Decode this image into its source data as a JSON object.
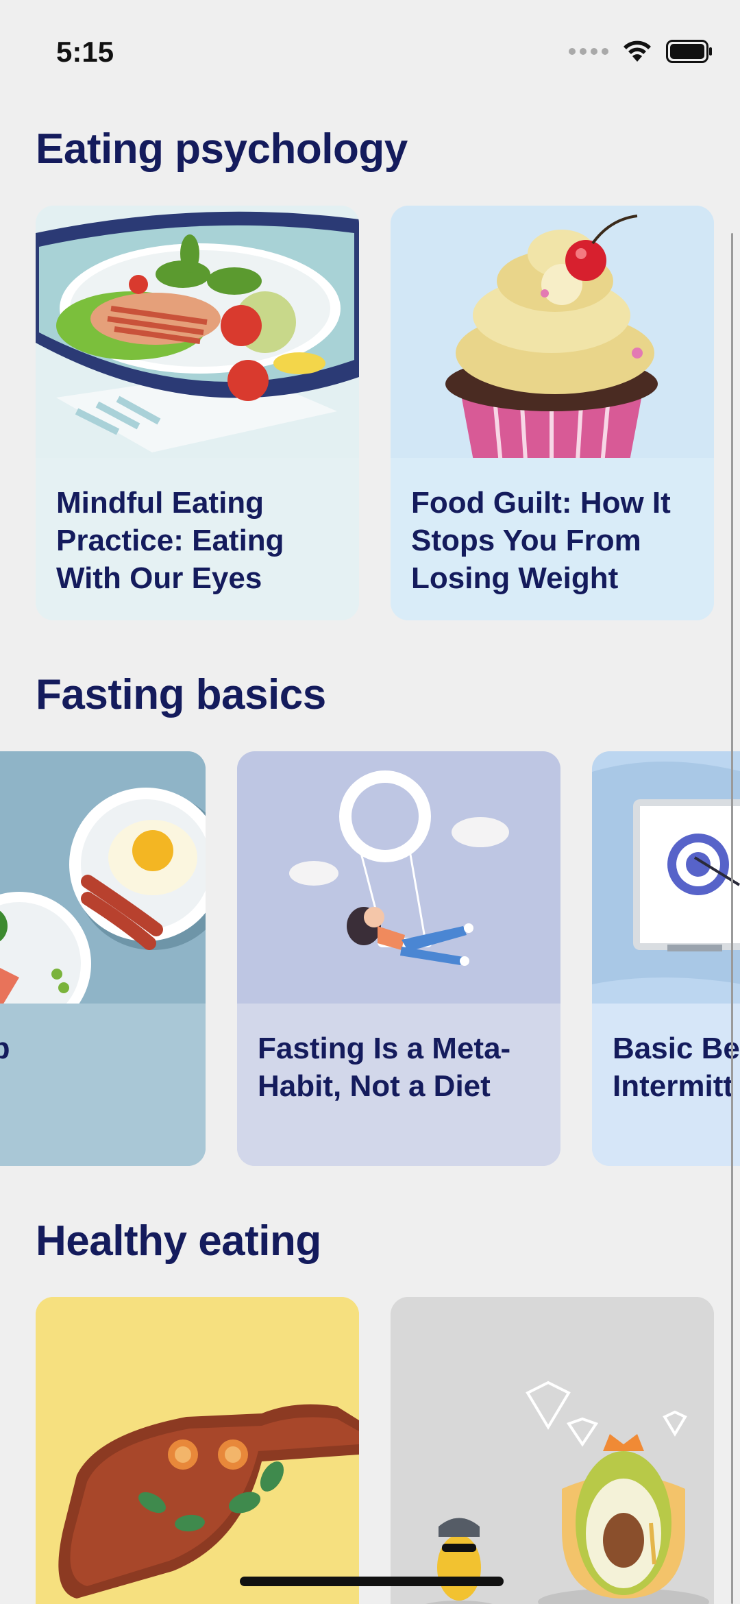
{
  "status_bar": {
    "time": "5:15"
  },
  "sections": [
    {
      "title": "Eating psychology",
      "cards": [
        {
          "title": "Mindful Eating Practice: Eating With Our Eyes",
          "icon": "salad-plate-illustration"
        },
        {
          "title": "Food Guilt: How It Stops You From Losing Weight",
          "icon": "cupcake-illustration"
        }
      ]
    },
    {
      "title": "Fasting basics",
      "cards": [
        {
          "title": "Should I Skip Breakfast or",
          "visible_text": "d I Skip\nfast or",
          "icon": "breakfast-plates-illustration"
        },
        {
          "title": "Fasting Is a Meta-Habit, Not a Diet",
          "icon": "swing-girl-illustration"
        },
        {
          "title": "Basic Be Intermitt",
          "visible_text": "Basic Be\nIntermitt",
          "icon": "target-board-illustration"
        }
      ]
    },
    {
      "title": "Healthy eating",
      "cards": [
        {
          "title": "",
          "icon": "cutting-board-illustration"
        },
        {
          "title": "",
          "icon": "avocado-king-illustration"
        }
      ]
    }
  ],
  "colors": {
    "background": "#efefef",
    "heading": "#141b5c",
    "card_mindful": "#e5f1f3",
    "card_guilt": "#d9ebf7",
    "card_breakfast": "#a9c7d6",
    "card_metahabit": "#d2d7ea",
    "card_basic": "#d6e6f8",
    "card_board": "#f6e07f",
    "card_avocado": "#d8d8d8"
  }
}
